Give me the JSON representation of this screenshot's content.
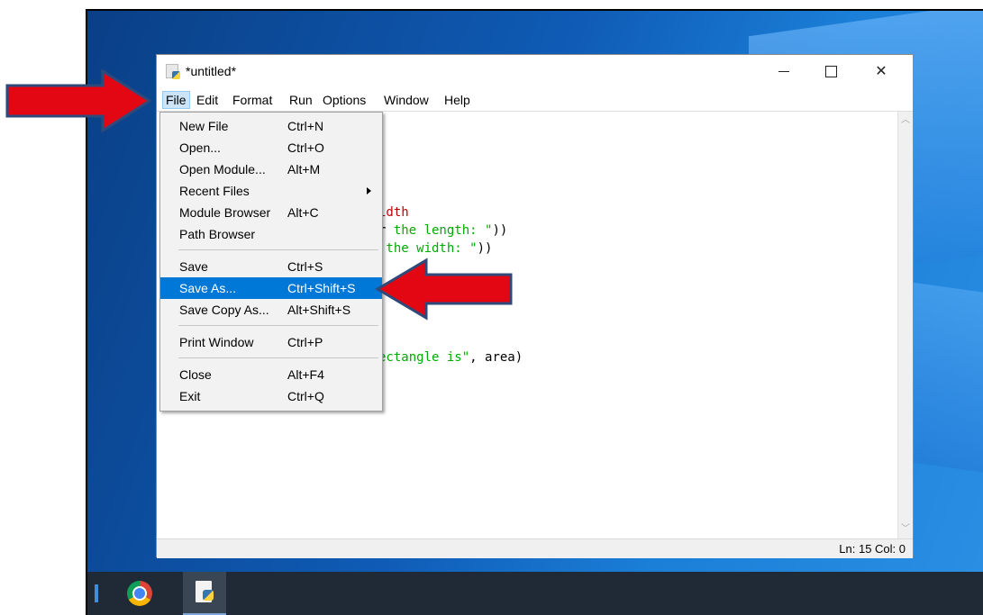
{
  "window": {
    "title": "*untitled*"
  },
  "menubar": {
    "items": [
      "File",
      "Edit",
      "Format",
      "Run",
      "Options",
      "Window",
      "Help"
    ]
  },
  "editor": {
    "visible_fragments": [
      {
        "text": "idth",
        "style": "red"
      },
      {
        "text": "r the length: \"))",
        "style": "mixed1"
      },
      {
        "text": " the width: \"))",
        "style": "mixed2"
      },
      {
        "text": "ectangle is\", area)",
        "style": "mixed3"
      }
    ]
  },
  "file_menu": {
    "items": [
      {
        "label": "New File",
        "accel": "Ctrl+N"
      },
      {
        "label": "Open...",
        "accel": "Ctrl+O"
      },
      {
        "label": "Open Module...",
        "accel": "Alt+M"
      },
      {
        "label": "Recent Files",
        "accel": ""
      },
      {
        "label": "Module Browser",
        "accel": "Alt+C"
      },
      {
        "label": "Path Browser",
        "accel": ""
      },
      {
        "label": "Save",
        "accel": "Ctrl+S"
      },
      {
        "label": "Save As...",
        "accel": "Ctrl+Shift+S"
      },
      {
        "label": "Save Copy As...",
        "accel": "Alt+Shift+S"
      },
      {
        "label": "Print Window",
        "accel": "Ctrl+P"
      },
      {
        "label": "Close",
        "accel": "Alt+F4"
      },
      {
        "label": "Exit",
        "accel": "Ctrl+Q"
      }
    ],
    "highlighted": "Save As..."
  },
  "status": {
    "text": "Ln: 15  Col: 0"
  },
  "taskbar": {
    "apps": [
      "chrome-icon",
      "idle-icon"
    ]
  },
  "colors": {
    "highlight": "#0078d7",
    "arrow_fill": "#e30613",
    "arrow_stroke": "#2f4a7a"
  }
}
